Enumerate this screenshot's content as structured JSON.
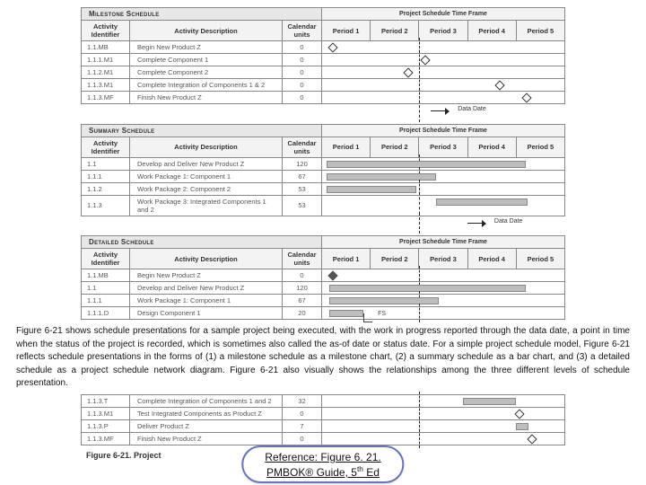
{
  "headers": {
    "activity_id": "Activity Identifier",
    "activity_desc": "Activity Description",
    "cal_units": "Calendar units",
    "timeframe": "Project Schedule Time Frame",
    "periods": [
      "Period 1",
      "Period 2",
      "Period 3",
      "Period 4",
      "Period 5"
    ]
  },
  "sections": {
    "milestone": {
      "title": "Milestone Schedule"
    },
    "summary": {
      "title": "Summary Schedule"
    },
    "detailed": {
      "title": "Detailed Schedule"
    }
  },
  "milestone_rows": [
    {
      "id": "1.1.MB",
      "desc": "Begin New Product Z",
      "units": "0",
      "pos": 3
    },
    {
      "id": "1.1.1.M1",
      "desc": "Complete Component 1",
      "units": "0",
      "pos": 41
    },
    {
      "id": "1.1.2.M1",
      "desc": "Complete Component 2",
      "units": "0",
      "pos": 34
    },
    {
      "id": "1.1.3.M1",
      "desc": "Complete Integration of Components 1 & 2",
      "units": "0",
      "pos": 72
    },
    {
      "id": "1.1.3.MF",
      "desc": "Finish New Product Z",
      "units": "0",
      "pos": 83
    }
  ],
  "summary_rows": [
    {
      "id": "1.1",
      "desc": "Develop and Deliver New Product Z",
      "units": "120",
      "bar": [
        2,
        84
      ]
    },
    {
      "id": "1.1.1",
      "desc": "Work Package 1: Component 1",
      "units": "67",
      "bar": [
        2,
        47
      ]
    },
    {
      "id": "1.1.2",
      "desc": "Work Package 2: Component 2",
      "units": "53",
      "bar": [
        2,
        39
      ]
    },
    {
      "id": "1.1.3",
      "desc": "Work Package 3: Integrated Components 1 and 2",
      "units": "53",
      "bar": [
        47,
        85
      ]
    }
  ],
  "detailed_rows_a": [
    {
      "id": "1.1.MB",
      "desc": "Begin New Product Z",
      "units": "0",
      "diamond": 3,
      "solid": true
    },
    {
      "id": "1.1",
      "desc": "Develop and Deliver New Product Z",
      "units": "120",
      "bar": [
        3,
        84
      ]
    },
    {
      "id": "1.1.1",
      "desc": "Work Package 1: Component 1",
      "units": "67",
      "bar": [
        3,
        48
      ]
    },
    {
      "id": "1.1.1.D",
      "desc": "Design Component 1",
      "units": "20",
      "bar": [
        3,
        17
      ],
      "fs": true
    }
  ],
  "detailed_rows_b": [
    {
      "id": "1.1.3.T",
      "desc": "Complete Integration of Components 1 and 2",
      "units": "32",
      "bar": [
        58,
        80
      ]
    },
    {
      "id": "1.1.3.M1",
      "desc": "Test Integrated Components as Product Z",
      "units": "0",
      "diamond": 80
    },
    {
      "id": "1.1.3.P",
      "desc": "Deliver Product Z",
      "units": "7",
      "bar": [
        80,
        85
      ]
    },
    {
      "id": "1.1.3.MF",
      "desc": "Finish New Product Z",
      "units": "0",
      "diamond": 85
    }
  ],
  "datadate": {
    "pos": 40,
    "label": "Data Date"
  },
  "caption": "Figure 6-21 shows schedule presentations for a sample project being executed, with the work in progress reported through the data date, a point in time when the status of the project is recorded, which is sometimes also called the as-of date or status date. For a simple project schedule model, Figure 6-21 reflects schedule presentations in the forms of (1) a milestone schedule as a milestone chart, (2) a summary schedule as a bar chart, and (3) a detailed schedule as a project schedule network diagram. Figure 6-21 also visually shows the relationships among the three different levels of schedule presentation.",
  "figcap": "Figure 6-21. Project",
  "fs_label": "FS",
  "reference": {
    "line1": "Reference: Figure 6. 21.",
    "line2a": "PMBOK® Guide, 5",
    "line2b": " Ed",
    "sup": "th"
  }
}
